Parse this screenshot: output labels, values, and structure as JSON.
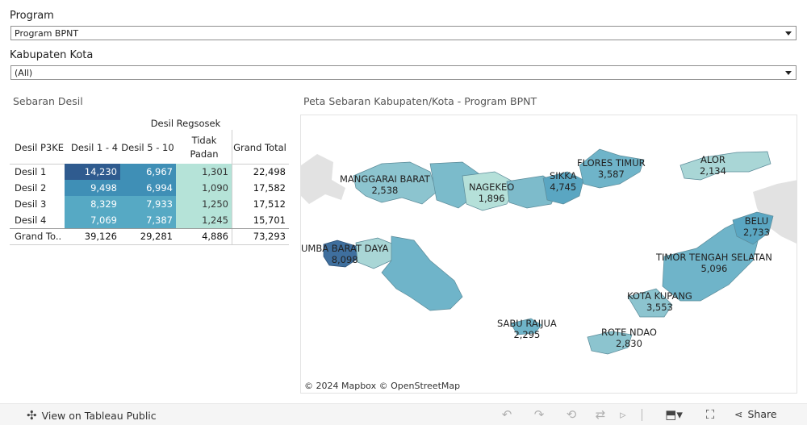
{
  "filters": {
    "program": {
      "label": "Program",
      "value": "Program BPNT"
    },
    "kabupaten": {
      "label": "Kabupaten Kota",
      "value": "(All)"
    }
  },
  "crosstab": {
    "title": "Sebaran Desil",
    "group_header": "Desil Regsosek",
    "row_header": "Desil P3KE",
    "columns": [
      "Desil 1 - 4",
      "Desil 5 - 10",
      "Tidak Padan",
      "Grand Total"
    ],
    "rows": [
      {
        "label": "Desil 1",
        "values": [
          "14,230",
          "6,967",
          "1,301",
          "22,498"
        ]
      },
      {
        "label": "Desil 2",
        "values": [
          "9,498",
          "6,994",
          "1,090",
          "17,582"
        ]
      },
      {
        "label": "Desil 3",
        "values": [
          "8,329",
          "7,933",
          "1,250",
          "17,512"
        ]
      },
      {
        "label": "Desil 4",
        "values": [
          "7,069",
          "7,387",
          "1,245",
          "15,701"
        ]
      }
    ],
    "total_row": {
      "label": "Grand To..",
      "values": [
        "39,126",
        "29,281",
        "4,886",
        "73,293"
      ]
    },
    "colors": {
      "dark": "#2f5b8f",
      "mid": "#3f8fb6",
      "teal": "#56a9c4",
      "light": "#b5e3d8"
    }
  },
  "map": {
    "title": "Peta Sebaran Kabupaten/Kota - Program BPNT",
    "attribution": "© 2024 Mapbox  © OpenStreetMap",
    "regions": [
      {
        "name": "MANGGARAI BARAT",
        "value": "2,538"
      },
      {
        "name": "NAGEKEO",
        "value": "1,896"
      },
      {
        "name": "SIKKA",
        "value": "4,745"
      },
      {
        "name": "FLORES TIMUR",
        "value": "3,587"
      },
      {
        "name": "ALOR",
        "value": "2,134"
      },
      {
        "name": "BELU",
        "value": "2,733"
      },
      {
        "name": "UMBA BARAT DAYA",
        "value": "8,098"
      },
      {
        "name": "TIMOR TENGAH SELATAN",
        "value": "5,096"
      },
      {
        "name": "KOTA KUPANG",
        "value": "3,553"
      },
      {
        "name": "SABU RAIJUA",
        "value": "2,295"
      },
      {
        "name": "ROTE NDAO",
        "value": "2,830"
      }
    ],
    "colors": {
      "land_fill": "#6fb4c9",
      "light_fill": "#a9d6d6",
      "dark_fill": "#3f6f9e",
      "background_land": "#e2e2e2"
    }
  },
  "toolbar": {
    "view_label": "View on Tableau Public",
    "share_label": "Share"
  }
}
